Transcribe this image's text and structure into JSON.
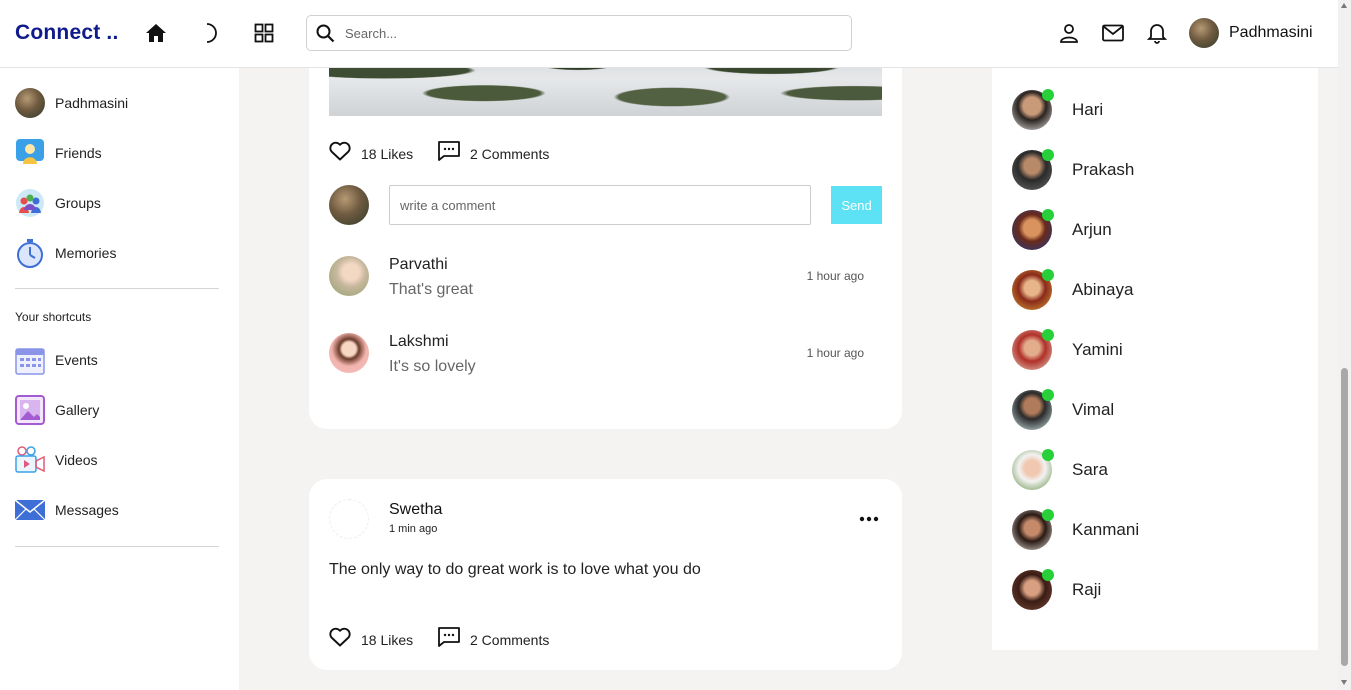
{
  "header": {
    "logo": "Connect ..",
    "search_placeholder": "Search...",
    "user_name": "Padhmasini"
  },
  "sidebar": {
    "items": [
      {
        "label": "Padhmasini",
        "icon": "user-avatar"
      },
      {
        "label": "Friends",
        "icon": "friends-icon"
      },
      {
        "label": "Groups",
        "icon": "groups-icon"
      },
      {
        "label": "Memories",
        "icon": "stopwatch-icon"
      }
    ],
    "shortcuts_heading": "Your shortcuts",
    "shortcuts": [
      {
        "label": "Events",
        "icon": "calendar-icon"
      },
      {
        "label": "Gallery",
        "icon": "gallery-icon"
      },
      {
        "label": "Videos",
        "icon": "video-icon"
      },
      {
        "label": "Messages",
        "icon": "envelope-icon"
      }
    ]
  },
  "post1": {
    "likes": "18 Likes",
    "comments": "2 Comments",
    "comment_placeholder": "write a comment",
    "send_label": "Send",
    "comment_list": [
      {
        "name": "Parvathi",
        "text": "That's great",
        "time": "1 hour ago"
      },
      {
        "name": "Lakshmi",
        "text": "It's so lovely",
        "time": "1 hour ago"
      }
    ]
  },
  "post2": {
    "author": "Swetha",
    "time": "1 min ago",
    "text": "The only way to do great work is to love what you do",
    "likes": "18 Likes",
    "comments": "2 Comments"
  },
  "online_friends": [
    {
      "name": "Hari"
    },
    {
      "name": "Prakash"
    },
    {
      "name": "Arjun"
    },
    {
      "name": "Abinaya"
    },
    {
      "name": "Yamini"
    },
    {
      "name": "Vimal"
    },
    {
      "name": "Sara"
    },
    {
      "name": "Kanmani"
    },
    {
      "name": "Raji"
    }
  ],
  "colors": {
    "brand": "#0f1a8c",
    "online": "#27d038",
    "send_button": "#5ce1f5"
  }
}
